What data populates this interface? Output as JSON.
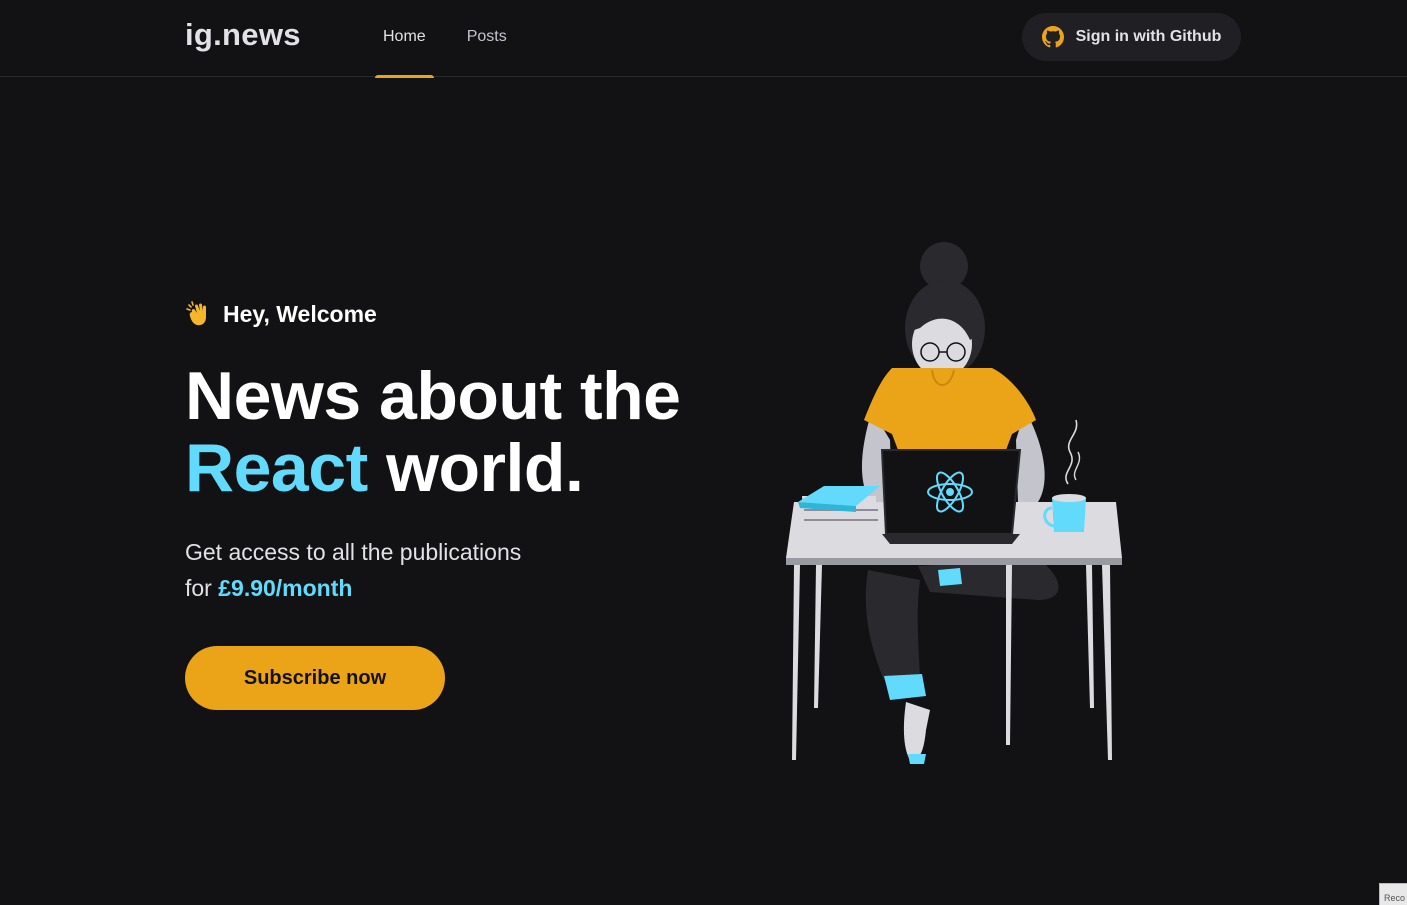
{
  "header": {
    "logo": "ig.news",
    "nav": [
      {
        "label": "Home",
        "active": true
      },
      {
        "label": "Posts",
        "active": false
      }
    ],
    "signin_label": "Sign in with Github",
    "github_icon_color": "#eba417"
  },
  "hero": {
    "welcome_emoji": "clapping-hands-icon",
    "welcome_text": "Hey, Welcome",
    "title_line1": "News about the",
    "title_accent": "React",
    "title_rest": "world.",
    "desc_line1": "Get access to all the publications",
    "desc_prefix": "for",
    "price": "£9.90/month",
    "cta_label": "Subscribe now"
  },
  "illustration": {
    "name": "avatar-illustration",
    "laptop_logo": "react-logo-icon"
  },
  "corner_tab_text": "Reco",
  "colors": {
    "background": "#121214",
    "accent_yellow": "#eba417",
    "accent_cyan": "#61dafb",
    "header_border": "#29292e",
    "button_dark": "#202024"
  }
}
